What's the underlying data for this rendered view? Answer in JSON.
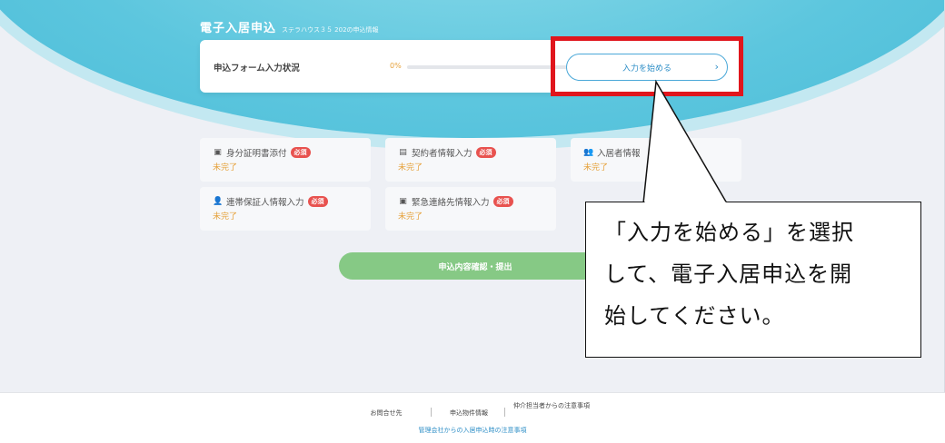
{
  "hero": {
    "title": "電子入居申込",
    "subtitle": "ステラハウス３５ 202の申込情報"
  },
  "status": {
    "label": "申込フォーム入力状況",
    "progress_text": "0%",
    "progress": 0,
    "start_button": "入力を始める",
    "start_chevron": "›"
  },
  "tasks": [
    {
      "icon": "id-card-icon",
      "glyph": "▣",
      "label": "身分証明書添付",
      "badge": "必須",
      "status": "未完了"
    },
    {
      "icon": "document-icon",
      "glyph": "▤",
      "label": "契約者情報入力",
      "badge": "必須",
      "status": "未完了"
    },
    {
      "icon": "users-icon",
      "glyph": "👥",
      "label": "入居者情報",
      "badge": "",
      "status": "未完了"
    },
    {
      "icon": "person-icon",
      "glyph": "👤",
      "label": "連帯保証人情報入力",
      "badge": "必須",
      "status": "未完了"
    },
    {
      "icon": "contact-card-icon",
      "glyph": "▣",
      "label": "緊急連絡先情報入力",
      "badge": "必須",
      "status": "未完了"
    }
  ],
  "submit_button": "申込内容確認・提出",
  "callout": {
    "lines": [
      "「入力を始める」を選択",
      "して、電子入居申込を開",
      "始してください。"
    ]
  },
  "footer": {
    "links": [
      "お問合せ先",
      "申込物件情報",
      "仲介担当者からの注意事項"
    ],
    "bottom_link": "管理会社からの入居申込時の注意事項"
  },
  "colors": {
    "accent": "#4bbcd8",
    "highlight": "#e0161d",
    "incomplete": "#e6a23c",
    "badge": "#e8524f",
    "submit": "#86c985"
  }
}
